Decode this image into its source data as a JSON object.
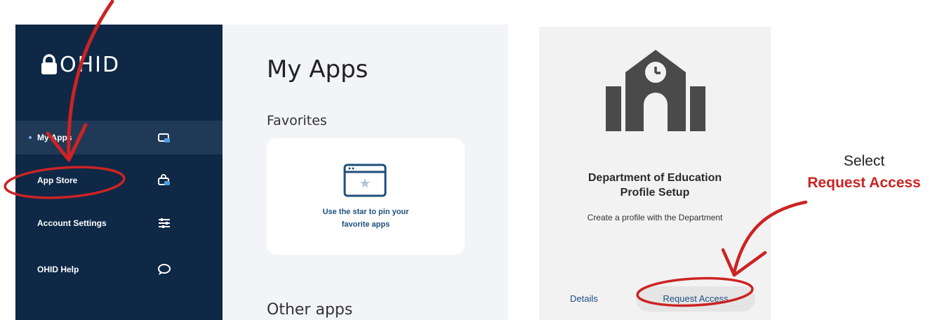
{
  "sidebar": {
    "brand": "OHID",
    "items": [
      {
        "label": "My Apps",
        "icon": "apps-card-icon",
        "active": true
      },
      {
        "label": "App Store",
        "icon": "store-bag-icon"
      },
      {
        "label": "Account Settings",
        "icon": "sliders-icon"
      },
      {
        "label": "OHID Help",
        "icon": "chat-bubble-icon"
      }
    ]
  },
  "main": {
    "title": "My Apps",
    "favorites_heading": "Favorites",
    "favorites_hint_line1": "Use the star to pin your",
    "favorites_hint_line2": "favorite apps",
    "other_heading": "Other apps"
  },
  "app_card": {
    "title_line1": "Department of Education",
    "title_line2": "Profile Setup",
    "description": "Create a profile with the Department",
    "details_label": "Details",
    "request_label": "Request Access",
    "icon": "school-clock-icon"
  },
  "annotation": {
    "select_text": "Select",
    "action_text": "Request Access",
    "color": "#cc2323"
  },
  "colors": {
    "sidebar": "#0e2846",
    "sidebar_active": "#1f3957",
    "link": "#1e4f7c",
    "annotation_red": "#cc2323"
  }
}
